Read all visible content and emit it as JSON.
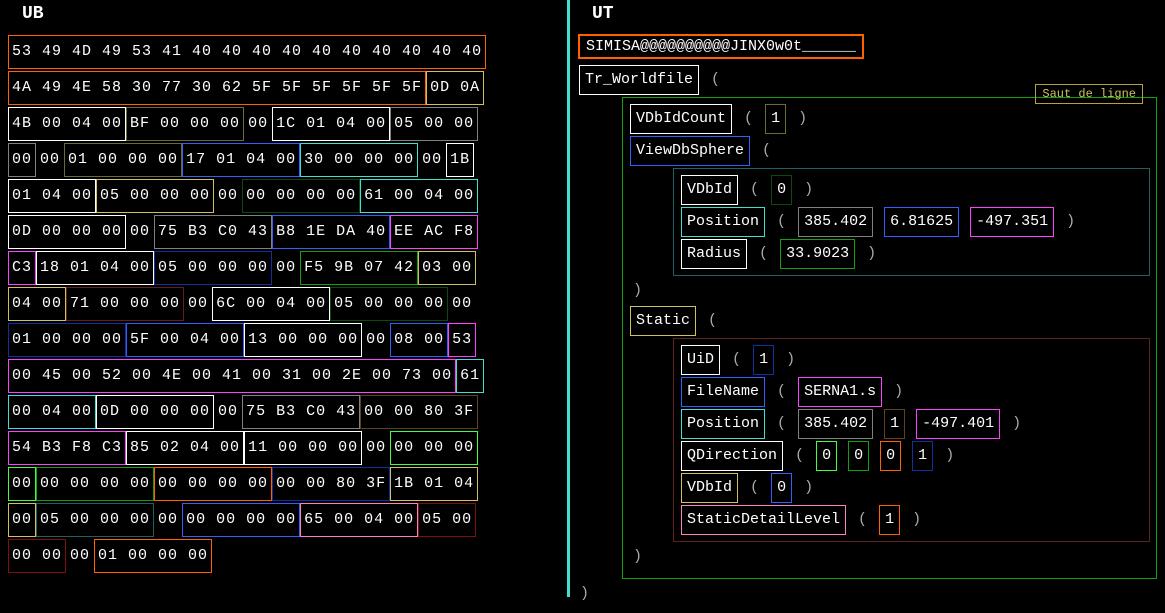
{
  "left": {
    "title": "UB",
    "rows": [
      [
        {
          "t": "53 49 4D 49 53 41 40 40 40 40 40 40 40 40 40 40",
          "c": "c-orange"
        }
      ],
      [
        {
          "t": "4A 49 4E 58 30 77 30 62 5F 5F 5F 5F 5F 5F",
          "c": "c-orange"
        },
        {
          "t": "0D 0A",
          "c": "c-yellow"
        }
      ],
      [
        {
          "t": "4B 00 04 00",
          "c": "c-white"
        },
        {
          "t": "BF 00 00 00",
          "c": "c-olive"
        },
        {
          "t": "00",
          "c": ""
        },
        {
          "t": "1C 01 04 00",
          "c": "c-white"
        },
        {
          "t": "05 00 00",
          "c": "c-gray"
        }
      ],
      [
        {
          "t": "00",
          "c": "c-gray"
        },
        {
          "t": "00",
          "c": ""
        },
        {
          "t": "01 00 00 00",
          "c": "c-olive"
        },
        {
          "t": "17 01 04 00",
          "c": "c-blue"
        },
        {
          "t": "30 00 00 00",
          "c": "c-cyan"
        },
        {
          "t": "00",
          "c": ""
        },
        {
          "t": "1B",
          "c": "c-white"
        }
      ],
      [
        {
          "t": "01 04 00",
          "c": "c-white"
        },
        {
          "t": "05 00 00 00",
          "c": "c-yellow"
        },
        {
          "t": "00",
          "c": ""
        },
        {
          "t": "00 00 00 00",
          "c": "c-dgreen"
        },
        {
          "t": "61 00 04 00",
          "c": "c-cyan"
        }
      ],
      [
        {
          "t": "0D 00 00 00",
          "c": "c-white"
        },
        {
          "t": "00",
          "c": ""
        },
        {
          "t": "75 B3 C0 43",
          "c": "c-gray"
        },
        {
          "t": "B8 1E DA 40",
          "c": "c-blue"
        },
        {
          "t": "EE AC F8",
          "c": "c-magenta"
        }
      ],
      [
        {
          "t": "C3",
          "c": "c-magenta"
        },
        {
          "t": "18 01 04 00",
          "c": "c-white"
        },
        {
          "t": "05 00 00 00",
          "c": "c-dblue"
        },
        {
          "t": "00",
          "c": ""
        },
        {
          "t": "F5 9B 07 42",
          "c": "c-green"
        },
        {
          "t": "03 00",
          "c": "c-yellow"
        }
      ],
      [
        {
          "t": "04 00",
          "c": "c-yellow"
        },
        {
          "t": "71 00 00 00",
          "c": "c-maroon"
        },
        {
          "t": "00",
          "c": ""
        },
        {
          "t": "6C 00 04 00",
          "c": "c-white"
        },
        {
          "t": "05 00 00 00",
          "c": "c-dgreen"
        },
        {
          "t": "00",
          "c": ""
        }
      ],
      [
        {
          "t": "01 00 00 00",
          "c": "c-dblue"
        },
        {
          "t": "5F 00 04 00",
          "c": "c-blue"
        },
        {
          "t": "13 00 00 00",
          "c": "c-white"
        },
        {
          "t": "00",
          "c": ""
        },
        {
          "t": "08 00",
          "c": "c-blue"
        },
        {
          "t": "53",
          "c": "c-magenta"
        }
      ],
      [
        {
          "t": "00 45 00 52 00 4E 00 41 00 31 00 2E 00 73 00",
          "c": "c-magenta"
        },
        {
          "t": "61",
          "c": "c-cyan"
        }
      ],
      [
        {
          "t": "00 04 00",
          "c": "c-cyan"
        },
        {
          "t": "0D 00 00 00",
          "c": "c-white"
        },
        {
          "t": "00",
          "c": ""
        },
        {
          "t": "75 B3 C0 43",
          "c": "c-gray"
        },
        {
          "t": "00 00 80 3F",
          "c": "c-brown"
        }
      ],
      [
        {
          "t": "54 B3 F8 C3",
          "c": "c-magenta"
        },
        {
          "t": "85 02 04 00",
          "c": "c-white"
        },
        {
          "t": "11 00 00 00",
          "c": "c-white"
        },
        {
          "t": "00",
          "c": ""
        },
        {
          "t": "00 00 00",
          "c": "c-lime"
        }
      ],
      [
        {
          "t": "00",
          "c": "c-lime"
        },
        {
          "t": "00 00 00 00",
          "c": "c-green"
        },
        {
          "t": "00 00 00 00",
          "c": "c-orange"
        },
        {
          "t": "00 00 80 3F",
          "c": "c-dblue"
        },
        {
          "t": "1B 01 04",
          "c": "c-yellow"
        }
      ],
      [
        {
          "t": "00",
          "c": "c-yellow"
        },
        {
          "t": "05 00 00 00",
          "c": "c-dcyan"
        },
        {
          "t": "00",
          "c": ""
        },
        {
          "t": "00 00 00 00",
          "c": "c-blue"
        },
        {
          "t": "65 00 04 00",
          "c": "c-pink"
        },
        {
          "t": "05 00",
          "c": "c-dred"
        }
      ],
      [
        {
          "t": "00 00",
          "c": "c-dred"
        },
        {
          "t": "00",
          "c": ""
        },
        {
          "t": "01 00 00 00",
          "c": "c-orange"
        }
      ]
    ]
  },
  "right": {
    "title": "UT",
    "header": "SIMISA@@@@@@@@@@JINX0w0t______",
    "newline_label": "Saut de ligne",
    "tree": {
      "root": {
        "label": "Tr_Worldfile",
        "c": "c-white"
      },
      "vdbidcount": {
        "label": "VDbIdCount",
        "c": "c-white",
        "val": "1",
        "vc": "c-olive"
      },
      "viewdbsphere": {
        "label": "ViewDbSphere",
        "c": "c-blue"
      },
      "vdbid1": {
        "label": "VDbId",
        "c": "c-white",
        "val": "0",
        "vc": "c-dgreen"
      },
      "position1": {
        "label": "Position",
        "c": "c-cyan",
        "v1": "385.402",
        "c1": "c-gray",
        "v2": "6.81625",
        "c2": "c-blue",
        "v3": "-497.351",
        "c3": "c-magenta"
      },
      "radius": {
        "label": "Radius",
        "c": "c-white",
        "val": "33.9023",
        "vc": "c-green"
      },
      "static": {
        "label": "Static",
        "c": "c-yellow"
      },
      "uid": {
        "label": "UiD",
        "c": "c-white",
        "val": "1",
        "vc": "c-dblue"
      },
      "filename": {
        "label": "FileName",
        "c": "c-blue",
        "val": "SERNA1.s",
        "vc": "c-magenta"
      },
      "position2": {
        "label": "Position",
        "c": "c-cyan",
        "v1": "385.402",
        "c1": "c-gray",
        "v2": "1",
        "c2": "c-brown",
        "v3": "-497.401",
        "c3": "c-magenta"
      },
      "qdirection": {
        "label": "QDirection",
        "c": "c-white",
        "v1": "0",
        "c1": "c-lime",
        "v2": "0",
        "c2": "c-green",
        "v3": "0",
        "c3": "c-orange",
        "v4": "1",
        "c4": "c-dblue"
      },
      "vdbid2": {
        "label": "VDbId",
        "c": "c-yellow",
        "val": "0",
        "vc": "c-blue"
      },
      "sdl": {
        "label": "StaticDetailLevel",
        "c": "c-pink",
        "val": "1",
        "vc": "c-orange"
      }
    }
  }
}
